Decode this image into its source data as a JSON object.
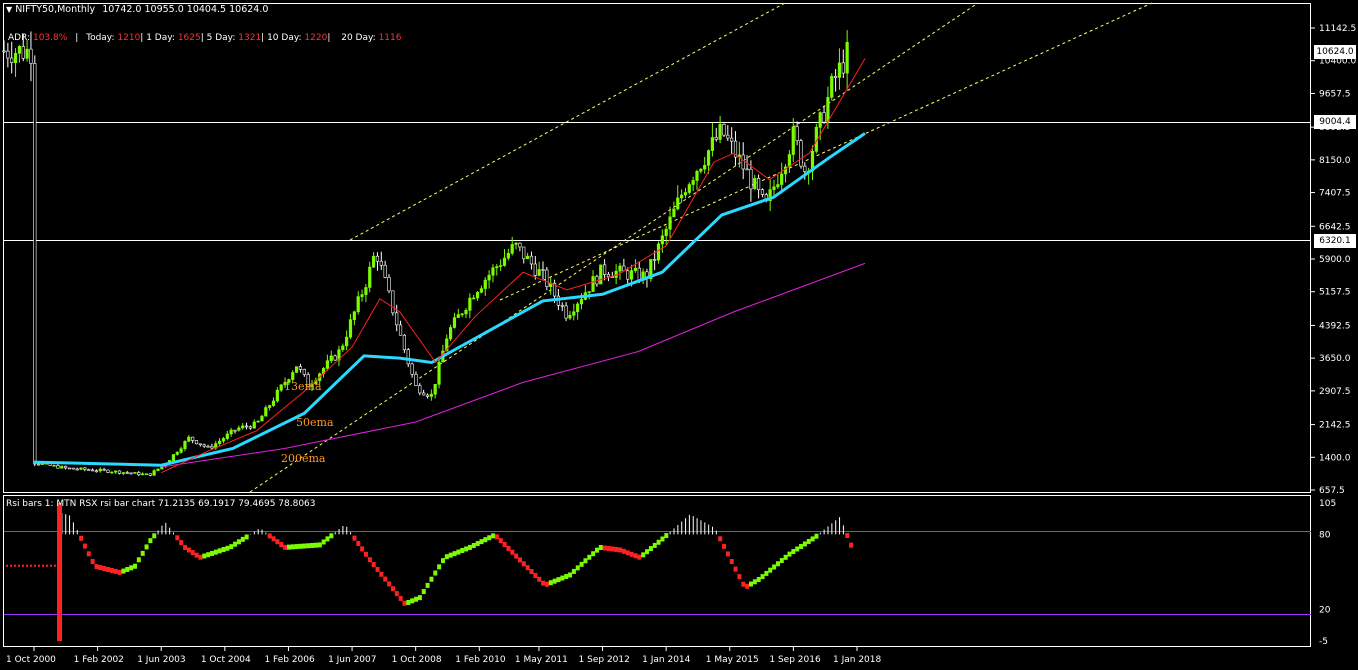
{
  "header": {
    "symbol": "NIFTY50,Monthly",
    "ohlc": "10742.0 10955.0 10404.5 10624.0",
    "adr_label": "ADR:",
    "adr_value": "103.8%",
    "today_label": "Today:",
    "today_value": "1210",
    "day1_label": "1 Day:",
    "day1_value": "1625",
    "day5_label": "5 Day:",
    "day5_value": "1321",
    "day10_label": "10 Day:",
    "day10_value": "1220",
    "day20_label": "20 Day:",
    "day20_value": "1116"
  },
  "price_axis": {
    "ticks": [
      "11142.5",
      "10400.0",
      "9657.5",
      "8892.5",
      "8150.0",
      "7407.5",
      "6642.5",
      "5900.0",
      "5157.5",
      "4392.5",
      "3650.0",
      "2907.5",
      "2142.5",
      "1400.0",
      "657.5"
    ],
    "current_price": "10624.0",
    "hline_upper": "9004.4",
    "hline_lower": "6320.1"
  },
  "ema_labels": {
    "ema13": "13ema",
    "ema50": "50ema",
    "ema200": "200ema"
  },
  "indicator": {
    "title": "Rsi bars 1: MTN RSX rsi bar chart 71.2135 69.1917 79.4695 78.8063",
    "ticks": [
      "105",
      "80",
      "20",
      "-5"
    ],
    "levels": [
      80,
      20
    ]
  },
  "time_axis": [
    "1 Oct 2000",
    "1 Feb 2002",
    "1 Jun 2003",
    "1 Oct 2004",
    "1 Feb 2006",
    "1 Jun 2007",
    "1 Oct 2008",
    "1 Feb 2010",
    "1 May 2011",
    "1 Sep 2012",
    "1 Jan 2014",
    "1 May 2015",
    "1 Sep 2016",
    "1 Jan 2018"
  ],
  "colors": {
    "background": "#000000",
    "bull": "#7CFC00",
    "ema13": "#ff2020",
    "ema50": "#29d9ff",
    "ema200": "#e020e0",
    "channel": "#ffff66",
    "rsi_up": "#7CFC00",
    "rsi_down": "#ff2020",
    "rsi_level": "#9933ff",
    "accent_red": "#ff3030"
  },
  "chart_data": {
    "type": "candlestick",
    "timeframe": "Monthly",
    "symbol": "NIFTY50",
    "last_ohlc": {
      "open": 10742.0,
      "high": 10955.0,
      "low": 10404.5,
      "close": 10624.0
    },
    "close_path": [
      [
        "2000-10",
        1280
      ],
      [
        "2001-06",
        1150
      ],
      [
        "2002-06",
        1080
      ],
      [
        "2003-03",
        1000
      ],
      [
        "2003-07",
        1250
      ],
      [
        "2004-01",
        1840
      ],
      [
        "2004-06",
        1600
      ],
      [
        "2005-01",
        2050
      ],
      [
        "2005-06",
        2150
      ],
      [
        "2006-04",
        3500
      ],
      [
        "2006-07",
        3050
      ],
      [
        "2007-03",
        3820
      ],
      [
        "2007-10",
        5500
      ],
      [
        "2007-12",
        6100
      ],
      [
        "2008-06",
        4200
      ],
      [
        "2008-10",
        3000
      ],
      [
        "2009-02",
        2800
      ],
      [
        "2009-06",
        4200
      ],
      [
        "2010-01",
        5200
      ],
      [
        "2010-11",
        6200
      ],
      [
        "2011-06",
        5500
      ],
      [
        "2011-12",
        4650
      ],
      [
        "2012-09",
        5650
      ],
      [
        "2013-08",
        5500
      ],
      [
        "2014-06",
        7600
      ],
      [
        "2015-03",
        8800
      ],
      [
        "2015-09",
        7900
      ],
      [
        "2016-02",
        7050
      ],
      [
        "2016-09",
        8700
      ],
      [
        "2016-12",
        7900
      ],
      [
        "2017-07",
        9900
      ],
      [
        "2018-01",
        11000
      ],
      [
        "2018-03",
        10624
      ]
    ],
    "ema13_path": [
      [
        "2003-06",
        1050
      ],
      [
        "2004-06",
        1550
      ],
      [
        "2005-06",
        2000
      ],
      [
        "2006-06",
        2900
      ],
      [
        "2007-06",
        3900
      ],
      [
        "2008-01",
        5000
      ],
      [
        "2008-06",
        4700
      ],
      [
        "2009-03",
        3550
      ],
      [
        "2010-01",
        4600
      ],
      [
        "2011-01",
        5600
      ],
      [
        "2011-12",
        5200
      ],
      [
        "2013-01",
        5550
      ],
      [
        "2014-01",
        6200
      ],
      [
        "2015-01",
        8100
      ],
      [
        "2015-06",
        8300
      ],
      [
        "2016-03",
        7700
      ],
      [
        "2017-01",
        8300
      ],
      [
        "2018-03",
        10450
      ]
    ],
    "ema50_path": [
      [
        "2000-10",
        1290
      ],
      [
        "2003-06",
        1220
      ],
      [
        "2004-12",
        1600
      ],
      [
        "2006-06",
        2400
      ],
      [
        "2007-09",
        3700
      ],
      [
        "2008-06",
        3650
      ],
      [
        "2009-02",
        3550
      ],
      [
        "2010-06",
        4350
      ],
      [
        "2011-06",
        4950
      ],
      [
        "2012-09",
        5100
      ],
      [
        "2013-12",
        5600
      ],
      [
        "2015-03",
        6900
      ],
      [
        "2016-04",
        7300
      ],
      [
        "2017-06",
        8200
      ],
      [
        "2018-03",
        8750
      ]
    ],
    "ema200_path": [
      [
        "2003-06",
        1180
      ],
      [
        "2006-01",
        1600
      ],
      [
        "2008-10",
        2200
      ],
      [
        "2011-01",
        3100
      ],
      [
        "2013-06",
        3800
      ],
      [
        "2015-06",
        4700
      ],
      [
        "2018-03",
        5800
      ]
    ],
    "horizontal_levels": [
      9004.4,
      6320.1
    ],
    "rsi": {
      "levels": [
        80,
        20
      ],
      "values": [
        71.2135,
        69.1917,
        79.4695,
        78.8063
      ]
    }
  }
}
